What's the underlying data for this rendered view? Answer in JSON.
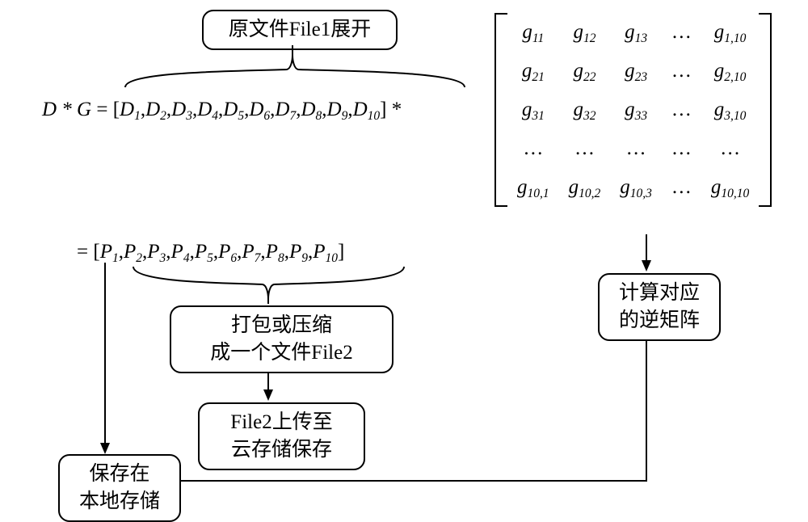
{
  "boxes": {
    "file1_expand": "原文件File1展开",
    "pack_l1": "打包或压缩",
    "pack_l2": "成一个文件File2",
    "upload_l1": "File2上传至",
    "upload_l2": "云存储保存",
    "inverse_l1": "计算对应",
    "inverse_l2": "的逆矩阵",
    "local_l1": "保存在",
    "local_l2": "本地存储"
  },
  "eq": {
    "lhs": "D * G",
    "eq": "=",
    "open": "[",
    "close": "]",
    "star": "*",
    "D": [
      "D",
      "D",
      "D",
      "D",
      "D",
      "D",
      "D",
      "D",
      "D",
      "D"
    ],
    "Dsub": [
      "1",
      "2",
      "3",
      "4",
      "5",
      "6",
      "7",
      "8",
      "9",
      "10"
    ],
    "P": [
      "P",
      "P",
      "P",
      "P",
      "P",
      "P",
      "P",
      "P",
      "P",
      "P"
    ],
    "Psub": [
      "1",
      "2",
      "3",
      "4",
      "5",
      "6",
      "7",
      "8",
      "9",
      "10"
    ]
  },
  "matrix": {
    "rows": [
      [
        {
          "b": "g",
          "s": "11"
        },
        {
          "b": "g",
          "s": "12"
        },
        {
          "b": "g",
          "s": "13"
        },
        {
          "b": "…",
          "s": ""
        },
        {
          "b": "g",
          "s": "1,10"
        }
      ],
      [
        {
          "b": "g",
          "s": "21"
        },
        {
          "b": "g",
          "s": "22"
        },
        {
          "b": "g",
          "s": "23"
        },
        {
          "b": "…",
          "s": ""
        },
        {
          "b": "g",
          "s": "2,10"
        }
      ],
      [
        {
          "b": "g",
          "s": "31"
        },
        {
          "b": "g",
          "s": "32"
        },
        {
          "b": "g",
          "s": "33"
        },
        {
          "b": "…",
          "s": ""
        },
        {
          "b": "g",
          "s": "3,10"
        }
      ],
      [
        {
          "b": "…",
          "s": ""
        },
        {
          "b": "…",
          "s": ""
        },
        {
          "b": "…",
          "s": ""
        },
        {
          "b": "…",
          "s": ""
        },
        {
          "b": "…",
          "s": ""
        }
      ],
      [
        {
          "b": "g",
          "s": "10,1"
        },
        {
          "b": "g",
          "s": "10,2"
        },
        {
          "b": "g",
          "s": "10,3"
        },
        {
          "b": "…",
          "s": ""
        },
        {
          "b": "g",
          "s": "10,10"
        }
      ]
    ]
  },
  "chart_data": {
    "type": "table",
    "title": "Encoding a file by matrix multiplication, packing, uploading, and saving inverse locally",
    "D_vector": [
      "D1",
      "D2",
      "D3",
      "D4",
      "D5",
      "D6",
      "D7",
      "D8",
      "D9",
      "D10"
    ],
    "G_matrix_rows_cols": [
      10,
      10
    ],
    "G_shown_entries": [
      "g11",
      "g12",
      "g13",
      "…",
      "g1,10",
      "g21",
      "g22",
      "g23",
      "…",
      "g2,10",
      "g31",
      "g32",
      "g33",
      "…",
      "g3,10",
      "…",
      "…",
      "…",
      "…",
      "…",
      "g10,1",
      "g10,2",
      "g10,3",
      "…",
      "g10,10"
    ],
    "P_vector": [
      "P1",
      "P2",
      "P3",
      "P4",
      "P5",
      "P6",
      "P7",
      "P8",
      "P9",
      "P10"
    ],
    "flow_edges": [
      [
        "原文件File1展开",
        "D-vector (brace)"
      ],
      [
        "G-matrix",
        "计算对应的逆矩阵"
      ],
      [
        "计算对应的逆矩阵",
        "保存在本地存储"
      ],
      [
        "P1",
        "保存在本地存储"
      ],
      [
        "P2..P10 (brace)",
        "打包或压缩成一个文件File2"
      ],
      [
        "打包或压缩成一个文件File2",
        "File2上传至云存储保存"
      ]
    ]
  }
}
